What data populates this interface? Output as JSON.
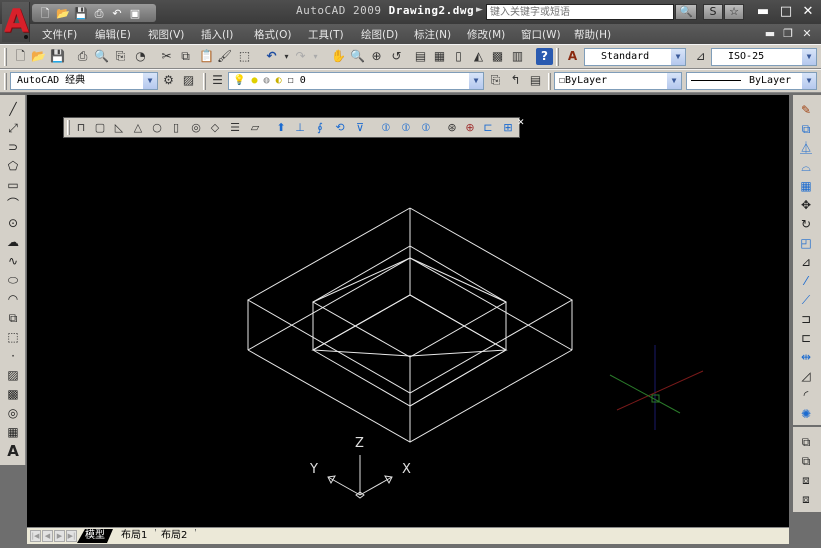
{
  "app": {
    "title_prefix": "AutoCAD 2009",
    "document_name": "Drawing2.dwg",
    "logo_letter": "A"
  },
  "quick_access": [
    "new-icon",
    "open-icon",
    "save-icon",
    "print-icon",
    "undo-icon",
    "publish-icon"
  ],
  "search": {
    "placeholder": "键入关键字或短语",
    "search_icon": "🔍",
    "subscription_icon": "S",
    "favorites_icon": "☆"
  },
  "window_controls": {
    "minimize": "▬",
    "maximize": "□",
    "close": "✕"
  },
  "menu": {
    "items": [
      {
        "label": "文件(F)"
      },
      {
        "label": "编辑(E)"
      },
      {
        "label": "视图(V)"
      },
      {
        "label": "插入(I)"
      },
      {
        "label": "格式(O)"
      },
      {
        "label": "工具(T)"
      },
      {
        "label": "绘图(D)"
      },
      {
        "label": "标注(N)"
      },
      {
        "label": "修改(M)"
      },
      {
        "label": "窗口(W)"
      },
      {
        "label": "帮助(H)"
      }
    ],
    "mdi_controls": {
      "minimize": "▬",
      "restore": "❐",
      "close": "✕"
    }
  },
  "standard_toolbar": {
    "icons": [
      "new",
      "open",
      "save",
      "plot",
      "plot-preview",
      "publish",
      "3d-print",
      "cut",
      "copy",
      "paste",
      "match-properties",
      "block-editor",
      "undo",
      "redo",
      "pan",
      "zoom-realtime",
      "zoom-window",
      "zoom-previous",
      "properties",
      "design-center",
      "tool-palettes",
      "sheet-set",
      "markup",
      "quickcalc",
      "help"
    ]
  },
  "styles": {
    "text_style": "Standard",
    "dim_style": "ISO-25"
  },
  "workspace": {
    "value": "AutoCAD 经典"
  },
  "layers": {
    "current_layer": "0",
    "color_control": "ByLayer",
    "linetype_control": "ByLayer"
  },
  "modeling_toolbar": {
    "icons": [
      "polysolid",
      "box",
      "wedge",
      "cone",
      "sphere",
      "cylinder",
      "torus",
      "pyramid",
      "helix",
      "planar-surface",
      "extrude",
      "presspull",
      "sweep",
      "revolve",
      "loft",
      "union",
      "subtract",
      "intersect",
      "3d-move",
      "3d-rotate",
      "section-plane",
      "3d-array"
    ]
  },
  "draw_toolbar": {
    "icons": [
      "line",
      "construction-line",
      "polyline",
      "polygon",
      "rectangle",
      "arc",
      "circle",
      "revision-cloud",
      "spline",
      "ellipse",
      "ellipse-arc",
      "insert-block",
      "make-block",
      "point",
      "hatch",
      "gradient",
      "region",
      "table",
      "multiline-text"
    ]
  },
  "modify_toolbar": {
    "icons": [
      "erase",
      "copy",
      "mirror",
      "offset",
      "array",
      "move",
      "rotate",
      "scale",
      "stretch",
      "trim",
      "extend",
      "break-at-point",
      "break",
      "join",
      "chamfer",
      "fillet",
      "explode"
    ]
  },
  "draworder_toolbar": {
    "icons": [
      "bring-to-front",
      "send-to-back",
      "bring-above",
      "send-under"
    ]
  },
  "ucs": {
    "x": "X",
    "y": "Y",
    "z": "Z"
  },
  "layout_tabs": {
    "tabs": [
      {
        "label": "模型",
        "active": true
      },
      {
        "label": "布局1",
        "active": false
      },
      {
        "label": "布局2",
        "active": false
      }
    ]
  },
  "colors": {
    "canvas": "#000000",
    "wireframe": "#e8e8e8",
    "accent_red": "#d8202a",
    "ui_gray": "#d4d0c8"
  }
}
